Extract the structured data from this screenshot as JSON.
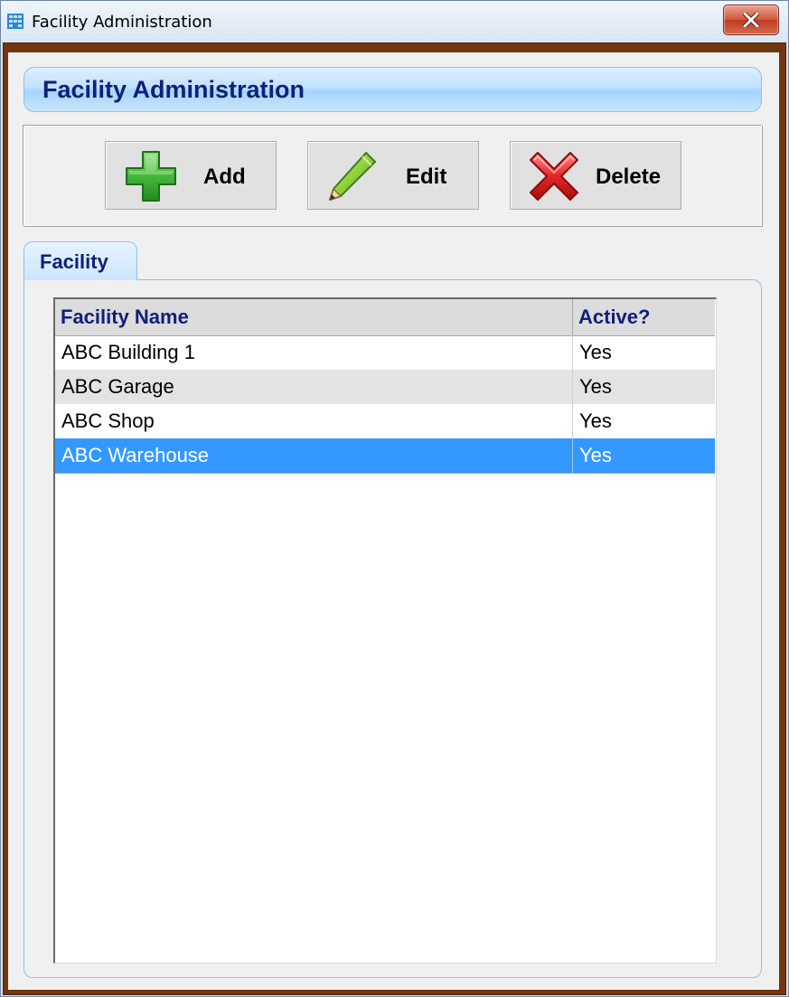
{
  "window": {
    "title": "Facility Administration",
    "icon": "building-icon",
    "close_icon": "close-icon"
  },
  "header": {
    "title": "Facility Administration"
  },
  "toolbar": {
    "add_label": "Add",
    "add_icon": "plus-icon",
    "edit_label": "Edit",
    "edit_icon": "pencil-icon",
    "delete_label": "Delete",
    "delete_icon": "x-icon"
  },
  "tabs": [
    {
      "label": "Facility",
      "active": true
    }
  ],
  "grid": {
    "columns": [
      "Facility Name",
      "Active?"
    ],
    "rows": [
      {
        "name": "ABC Building 1",
        "active": "Yes"
      },
      {
        "name": "ABC Garage",
        "active": "Yes"
      },
      {
        "name": "ABC Shop",
        "active": "Yes"
      },
      {
        "name": "ABC Warehouse",
        "active": "Yes",
        "selected": true
      }
    ]
  },
  "colors": {
    "header_text": "#10207a",
    "frame": "#71360f",
    "selection": "#3399ff",
    "banner": "#bfe1fd"
  }
}
